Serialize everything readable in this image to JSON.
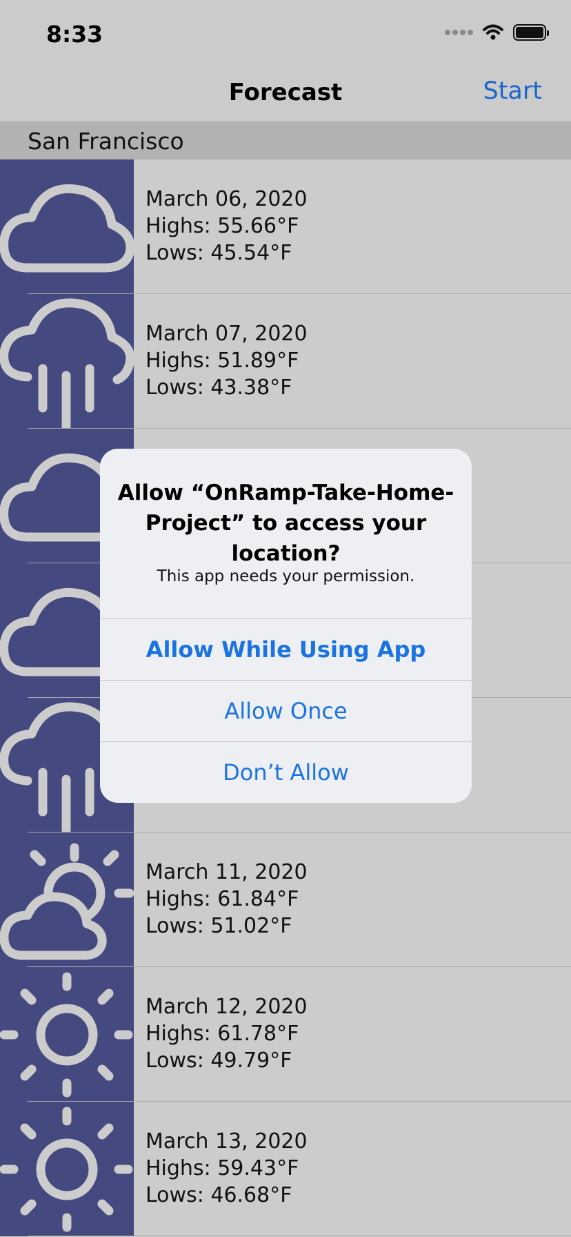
{
  "status_bar": {
    "time": "8:33"
  },
  "nav": {
    "title": "Forecast",
    "right_button": "Start"
  },
  "section": {
    "title": "San Francisco"
  },
  "forecast": [
    {
      "date": "March 06, 2020",
      "highs": "Highs: 55.66°F",
      "lows": "Lows: 45.54°F",
      "icon": "cloud-icon"
    },
    {
      "date": "March 07, 2020",
      "highs": "Highs: 51.89°F",
      "lows": "Lows: 43.38°F",
      "icon": "rain-icon"
    },
    {
      "date": "",
      "highs": "",
      "lows": "",
      "icon": "cloud-icon"
    },
    {
      "date": "",
      "highs": "",
      "lows": "",
      "icon": "cloud-icon"
    },
    {
      "date": "",
      "highs": "",
      "lows": "",
      "icon": "rain-icon"
    },
    {
      "date": "March 11, 2020",
      "highs": "Highs: 61.84°F",
      "lows": "Lows: 51.02°F",
      "icon": "partly-cloudy-icon"
    },
    {
      "date": "March 12, 2020",
      "highs": "Highs: 61.78°F",
      "lows": "Lows: 49.79°F",
      "icon": "sun-icon"
    },
    {
      "date": "March 13, 2020",
      "highs": "Highs: 59.43°F",
      "lows": "Lows: 46.68°F",
      "icon": "sun-icon"
    }
  ],
  "alert": {
    "title": "Allow “OnRamp-Take-Home-Project” to access your location?",
    "message": "This app needs your permission.",
    "buttons": [
      "Allow While Using App",
      "Allow Once",
      "Don’t Allow"
    ]
  },
  "colors": {
    "accent": "#1a73e0",
    "icon_column": "#44497f",
    "icon_stroke": "#cccccc",
    "background": "#cccccc"
  }
}
